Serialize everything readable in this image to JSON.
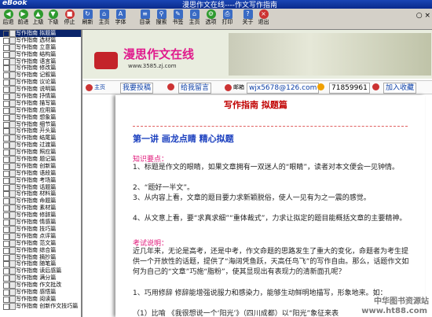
{
  "window": {
    "app_name": "eBook",
    "title": "漫思作文在线----作文写作指南"
  },
  "toolbar": {
    "buttons": [
      {
        "label": "后退",
        "icon": "back-icon"
      },
      {
        "label": "前进",
        "icon": "forward-icon"
      },
      {
        "label": "上级",
        "icon": "up-icon"
      },
      {
        "label": "下级",
        "icon": "down-icon"
      },
      {
        "label": "停止",
        "icon": "stop-icon"
      },
      {
        "label": "刷新",
        "icon": "refresh-icon"
      },
      {
        "label": "主页",
        "icon": "home-icon"
      },
      {
        "label": "字体",
        "icon": "font-icon"
      },
      {
        "label": "目录",
        "icon": "toc-icon"
      },
      {
        "label": "搜索",
        "icon": "search-icon"
      },
      {
        "label": "书签",
        "icon": "bookmark-icon"
      },
      {
        "label": "主页",
        "icon": "home-icon"
      },
      {
        "label": "选项",
        "icon": "options-icon"
      },
      {
        "label": "打印",
        "icon": "print-icon"
      },
      {
        "label": "关于",
        "icon": "about-icon"
      },
      {
        "label": "退出",
        "icon": "exit-icon"
      }
    ],
    "right_label": "○ ×"
  },
  "sidebar": {
    "items": [
      "写作指南 拟题篇",
      "写作指南 选材篇",
      "写作指南 立意篇",
      "写作指南 结构篇",
      "写作指南 语言篇",
      "写作指南 修改篇",
      "写作指南 记叙篇",
      "写作指南 议论篇",
      "写作指南 说明篇",
      "写作指南 抒情篇",
      "写作指南 描写篇",
      "写作指南 应用篇",
      "写作指南 想象篇",
      "写作指南 细节篇",
      "写作指南 开头篇",
      "写作指南 结尾篇",
      "写作指南 过渡篇",
      "写作指南 照应篇",
      "写作指南 题记篇",
      "写作指南 创新篇",
      "写作指南 语段篇",
      "写作指南 考场篇",
      "写作指南 话题篇",
      "写作指南 材料篇",
      "写作指南 命题篇",
      "写作指南 素材篇",
      "写作指南 修辞篇",
      "写作指南 情感篇",
      "写作指南 技巧篇",
      "写作指南 点评篇",
      "写作指南 范文篇",
      "写作指南 综合篇",
      "写作指南 摘抄篇",
      "写作指南 随笔篇",
      "写作指南 读后感篇",
      "写作指南 满分篇",
      "写作指南 作文批改",
      "写作指南 感悟篇",
      "写作指南 阅读篇",
      "写作指南 创新作文技巧篇"
    ]
  },
  "banner": {
    "logo": "漫思作文在线",
    "url": "www.3585.zj.com"
  },
  "navbar": {
    "home": "主页",
    "post": "我要投稿",
    "guestbook": "给我留言",
    "email_label": "邮箱",
    "email": "wjx5678@126.com",
    "qq": "71859961",
    "favorite": "加入收藏"
  },
  "article": {
    "title": "写作指南  拟题篇",
    "lecture": "第一讲  画龙点睛  精心拟题",
    "section1_head": "知识要点：",
    "section1_lines": [
      "1、标题是作文的眼睛，如果文章拥有一双迷人的“眼睛”，读者对本文便会一见钟情。",
      "2、“题好一半文”。",
      "3、从内容上看，文章的题目要力求新颖脱俗，使人一见有为之一震的感觉。",
      "4、从文意上看，要“求真求细”“重体裁式”，力求让拟定的题目能概括文章的主要精神。"
    ],
    "section2_head": "考试说明：",
    "section2_text": "近几年来，无论是高考，还是中考，作文命题的思路发生了重大的变化，命题者为考生提供一个开放性的话题，提供了“海阔凭鱼跃，天高任鸟飞”的写作自由。那么，话题作文如何为自己的“文章”巧施“脂粉”，使其显现出有表现力的清新面孔呢？",
    "section3_text": "1、巧用修辞  修辞能增强说服力和感染力，能够生动鲜明地描写，形象地来。如：",
    "section3_line2": "（1）比喻  《我很想说一个‘阳光’》（四川成都）以“阳光”象征来表",
    "watermark": "中华图书资源站",
    "watermark_url": "www.ht88.com"
  }
}
